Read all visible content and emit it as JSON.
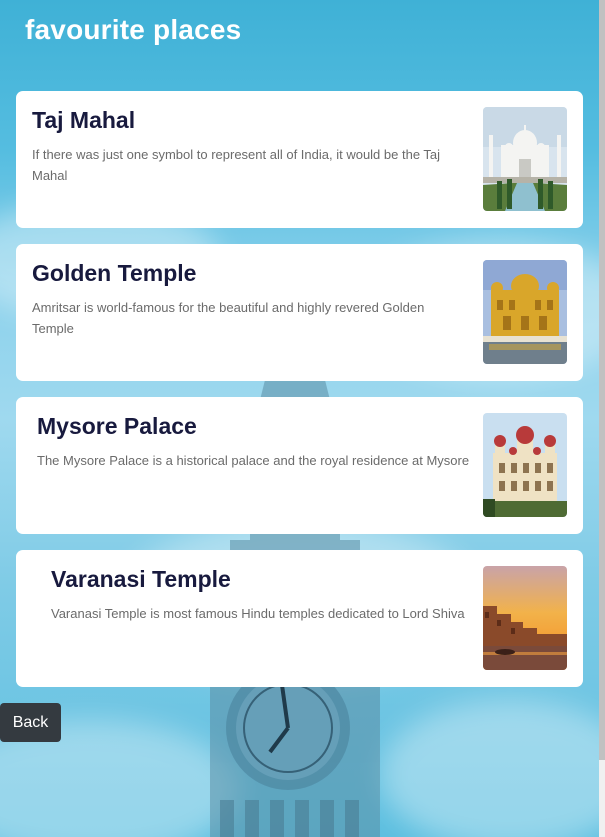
{
  "header": {
    "title": "favourite places"
  },
  "places": [
    {
      "title": "Taj Mahal",
      "description": "If there was just one symbol to represent all of India, it would be the Taj Mahal",
      "image": "taj-mahal-photo"
    },
    {
      "title": "Golden Temple",
      "description": "Amritsar is world-famous for the beautiful and highly revered Golden Temple",
      "image": "golden-temple-photo"
    },
    {
      "title": "Mysore Palace",
      "description": "The Mysore Palace is a historical palace and the royal residence at Mysore",
      "image": "mysore-palace-photo"
    },
    {
      "title": "Varanasi Temple",
      "description": "Varanasi Temple is most famous Hindu temples dedicated to Lord Shiva",
      "image": "varanasi-temple-photo"
    }
  ],
  "footer": {
    "back_label": "Back"
  },
  "colors": {
    "title_text": "#181a3e",
    "description_text": "#6b6b6b",
    "back_button": "#343a40",
    "background_sky": "#5cbfe0"
  }
}
